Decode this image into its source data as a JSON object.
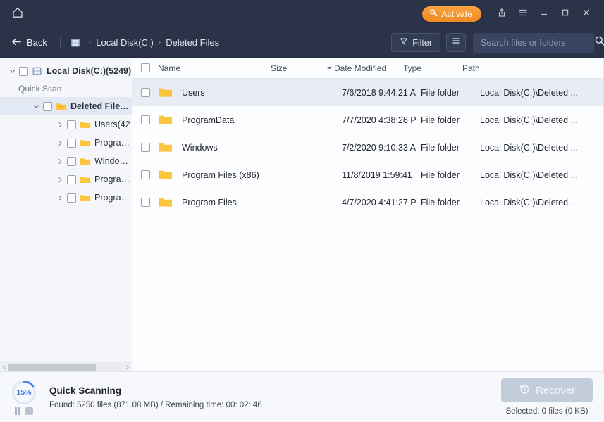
{
  "titlebar": {
    "home_icon": "home-icon",
    "activate_label": "Activate",
    "activate_icon": "key-icon",
    "activate_color": "#f49a33",
    "share_icon": "share-icon",
    "menu_icon": "hamburger-menu-icon",
    "minimize_icon": "minimize-icon",
    "maximize_icon": "maximize-icon",
    "close_icon": "close-icon",
    "background": "#2b3349"
  },
  "navbar": {
    "back_label": "Back",
    "back_icon": "arrow-left-icon",
    "breadcrumbs": [
      {
        "label": "Local Disk(C:)",
        "icon": "disk-icon"
      },
      {
        "label": "Deleted Files",
        "icon": ""
      }
    ],
    "separator": "›",
    "filter_label": "Filter",
    "filter_icon": "funnel-icon",
    "view_icon": "list-view-icon",
    "search_placeholder": "Search files or folders",
    "search_value": "",
    "search_icon": "search-icon"
  },
  "sidebar": {
    "root": {
      "label": "Local Disk(C:)(5249)",
      "icon": "disk-icon",
      "expander": "chevron-down-icon",
      "checked": false
    },
    "scan_mode": "Quick Scan",
    "deleted_node": {
      "label": "Deleted Files...",
      "icon": "folder-open-icon",
      "expander": "chevron-down-icon",
      "selected": true,
      "checked": false
    },
    "children": [
      {
        "label": "Users(42",
        "icon": "folder-icon",
        "expander": "chevron-right-icon",
        "checked": false
      },
      {
        "label": "Program...",
        "icon": "folder-icon",
        "expander": "chevron-right-icon",
        "checked": false
      },
      {
        "label": "Windows...",
        "icon": "folder-icon",
        "expander": "chevron-right-icon",
        "checked": false
      },
      {
        "label": "Program ...",
        "icon": "folder-icon",
        "expander": "chevron-right-icon",
        "checked": false
      },
      {
        "label": "Program ...",
        "icon": "folder-icon",
        "expander": "chevron-right-icon",
        "checked": false
      }
    ],
    "scrollbar": {
      "left_arrow": "chevron-left-icon",
      "right_arrow": "chevron-right-icon"
    }
  },
  "table": {
    "columns": {
      "name": "Name",
      "size": "Size",
      "date": "Date Modified",
      "type": "Type",
      "path": "Path"
    },
    "sort_icon": "sort-descending-caret-icon",
    "header_checked": false,
    "rows": [
      {
        "name": "Users",
        "size": "",
        "date": "7/6/2018 9:44:21 A",
        "type": "File folder",
        "path": "Local Disk(C:)\\Deleted ...",
        "selected": true,
        "checked": false
      },
      {
        "name": "ProgramData",
        "size": "",
        "date": "7/7/2020 4:38:26 P",
        "type": "File folder",
        "path": "Local Disk(C:)\\Deleted ...",
        "selected": false,
        "checked": false
      },
      {
        "name": "Windows",
        "size": "",
        "date": "7/2/2020 9:10:33 A",
        "type": "File folder",
        "path": "Local Disk(C:)\\Deleted ...",
        "selected": false,
        "checked": false
      },
      {
        "name": "Program Files (x86)",
        "size": "",
        "date": "11/8/2019 1:59:41",
        "type": "File folder",
        "path": "Local Disk(C:)\\Deleted ...",
        "selected": false,
        "checked": false
      },
      {
        "name": "Program Files",
        "size": "",
        "date": "4/7/2020 4:41:27 P",
        "type": "File folder",
        "path": "Local Disk(C:)\\Deleted ...",
        "selected": false,
        "checked": false
      }
    ]
  },
  "statusbar": {
    "progress_percent": "15%",
    "progress_value": 15,
    "progress_color": "#4a86e8",
    "pause_icon": "pause-icon",
    "stop_icon": "stop-icon",
    "title": "Quick Scanning",
    "details": "Found: 5250 files (871.08 MB) / Remaining time: 00: 02: 46",
    "recover_label": "Recover",
    "recover_icon": "restore-clock-icon",
    "recover_enabled": false,
    "selected_text": "Selected: 0 files (0 KB)"
  }
}
